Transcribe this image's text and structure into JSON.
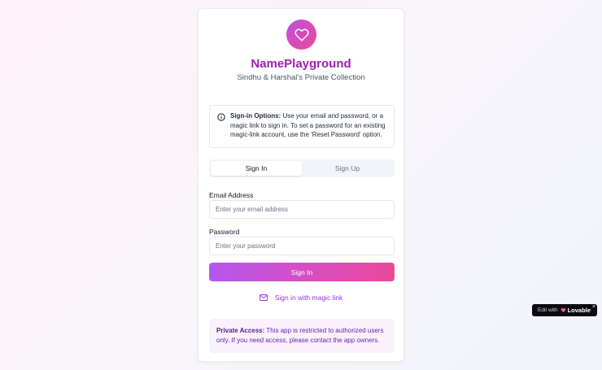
{
  "app": {
    "title": "NamePlayground",
    "subtitle": "Sindhu & Harshal's Private Collection"
  },
  "info": {
    "heading": "Sign-in Options:",
    "text": " Use your email and password, or a magic link to sign in. To set a password for an existing magic-link account, use the 'Reset Password' option."
  },
  "tabs": [
    {
      "label": "Sign In",
      "active": true
    },
    {
      "label": "Sign Up",
      "active": false
    }
  ],
  "form": {
    "email_label": "Email Address",
    "email_placeholder": "Enter your email address",
    "password_label": "Password",
    "password_placeholder": "Enter your password",
    "submit_label": "Sign In",
    "magic_link_label": "Sign in with magic link"
  },
  "private_notice": {
    "heading": "Private Access:",
    "text": " This app is restricted to authorized users only. If you need access, please contact the app owners."
  },
  "badge": {
    "prefix": "Edit with",
    "brand": "Lovable",
    "close": "×"
  },
  "colors": {
    "accent": "#a21caf",
    "gradient_start": "#b557ee",
    "gradient_end": "#ec4899"
  },
  "icons": {
    "logo": "heart-icon",
    "info": "info-icon",
    "magic_link": "mail-icon",
    "badge": "lovable-heart-icon"
  }
}
